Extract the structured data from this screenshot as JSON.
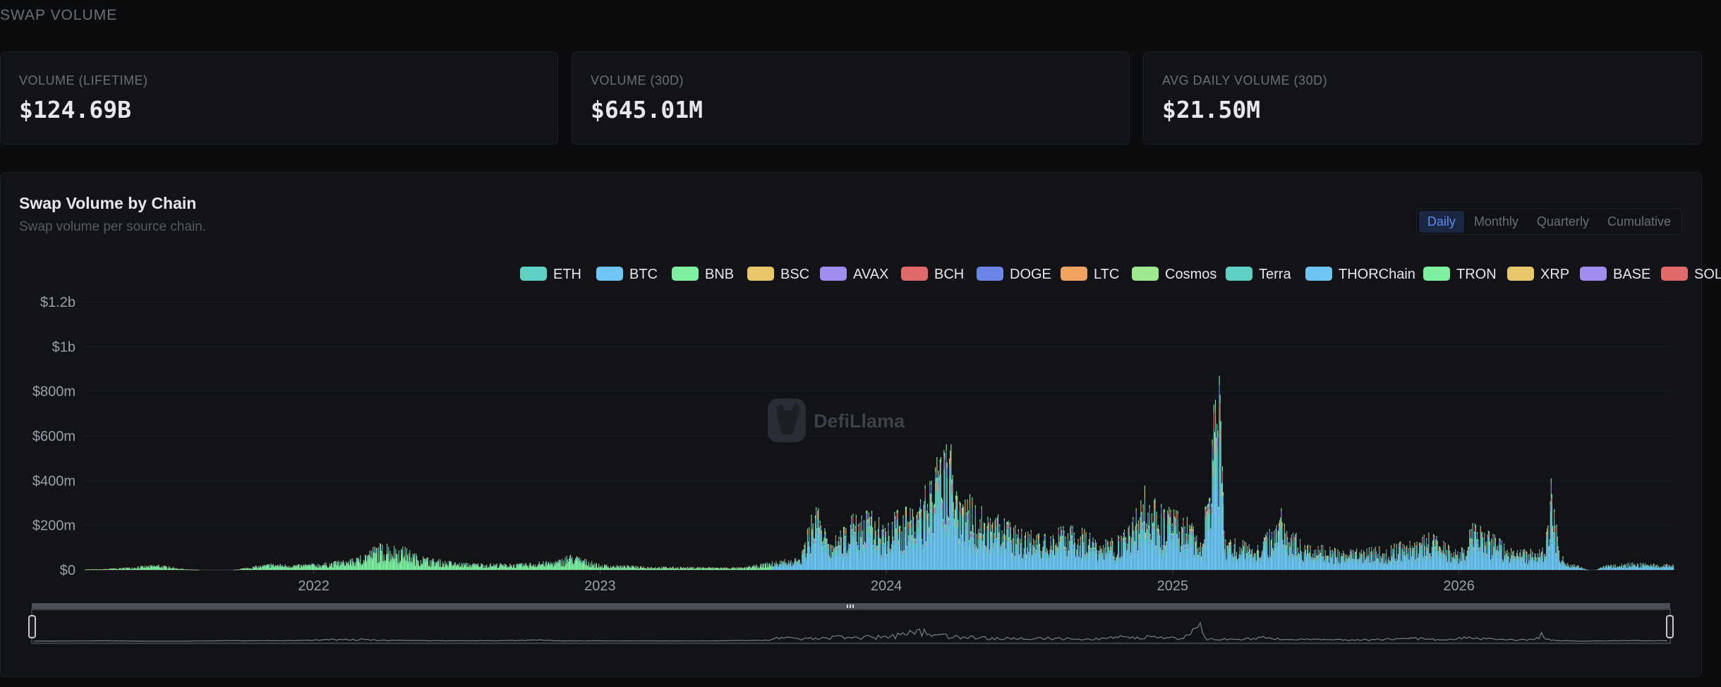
{
  "section_title": "SWAP VOLUME",
  "stats": [
    {
      "label": "VOLUME (LIFETIME)",
      "value": "$124.69B"
    },
    {
      "label": "VOLUME (30D)",
      "value": "$645.01M"
    },
    {
      "label": "AVG DAILY VOLUME (30D)",
      "value": "$21.50M"
    }
  ],
  "tabs": [
    {
      "label": "Daily",
      "active": true
    },
    {
      "label": "Monthly",
      "active": false
    },
    {
      "label": "Quarterly",
      "active": false
    },
    {
      "label": "Cumulative",
      "active": false
    }
  ],
  "watermark": "DefiLlama",
  "chart_data": {
    "type": "bar",
    "stacked": true,
    "title": "Swap Volume by Chain",
    "subtitle": "Swap volume per source chain.",
    "y_axis": {
      "min": 0,
      "max": 1200000000,
      "ticks": [
        0,
        200000000,
        400000000,
        600000000,
        800000000,
        1000000000,
        1200000000
      ],
      "tick_labels": [
        "$0",
        "$200m",
        "$400m",
        "$600m",
        "$800m",
        "$1b",
        "$1.2b"
      ]
    },
    "x_axis": {
      "range": [
        2021.2,
        2026.75
      ],
      "ticks": [
        2022,
        2023,
        2024,
        2025,
        2026
      ],
      "tick_labels": [
        "2022",
        "2023",
        "2024",
        "2025",
        "2026"
      ]
    },
    "grid": true,
    "legend_position": "top-right",
    "legend": [
      {
        "name": "ETH",
        "color": "#5ed1c4"
      },
      {
        "name": "BTC",
        "color": "#6ec6f5"
      },
      {
        "name": "BNB",
        "color": "#7ef0a0"
      },
      {
        "name": "BSC",
        "color": "#e8c76a"
      },
      {
        "name": "AVAX",
        "color": "#a18cf0"
      },
      {
        "name": "BCH",
        "color": "#e06a6a"
      },
      {
        "name": "DOGE",
        "color": "#6c86e8"
      },
      {
        "name": "LTC",
        "color": "#f0a35e"
      },
      {
        "name": "Cosmos",
        "color": "#a0e890"
      },
      {
        "name": "Terra",
        "color": "#5ed1c4"
      },
      {
        "name": "THORChain",
        "color": "#6ec6f5"
      },
      {
        "name": "TRON",
        "color": "#7ef0a0"
      },
      {
        "name": "XRP",
        "color": "#e8c76a"
      },
      {
        "name": "BASE",
        "color": "#a18cf0"
      },
      {
        "name": "SOL",
        "color": "#e06a6a"
      }
    ],
    "envelope": [
      [
        2021.25,
        3000000
      ],
      [
        2021.35,
        12000000
      ],
      [
        2021.45,
        25000000
      ],
      [
        2021.5,
        15000000
      ],
      [
        2021.55,
        3000000
      ],
      [
        2021.6,
        0
      ],
      [
        2021.72,
        0
      ],
      [
        2021.75,
        8000000
      ],
      [
        2021.85,
        30000000
      ],
      [
        2021.95,
        25000000
      ],
      [
        2022.05,
        35000000
      ],
      [
        2022.15,
        55000000
      ],
      [
        2022.22,
        120000000
      ],
      [
        2022.3,
        115000000
      ],
      [
        2022.38,
        60000000
      ],
      [
        2022.5,
        35000000
      ],
      [
        2022.7,
        28000000
      ],
      [
        2022.85,
        45000000
      ],
      [
        2022.9,
        75000000
      ],
      [
        2023.0,
        25000000
      ],
      [
        2023.2,
        15000000
      ],
      [
        2023.5,
        12000000
      ],
      [
        2023.6,
        40000000
      ],
      [
        2023.7,
        60000000
      ],
      [
        2023.75,
        350000000
      ],
      [
        2023.8,
        120000000
      ],
      [
        2023.9,
        280000000
      ],
      [
        2024.0,
        250000000
      ],
      [
        2024.1,
        300000000
      ],
      [
        2024.18,
        520000000
      ],
      [
        2024.22,
        580000000
      ],
      [
        2024.28,
        350000000
      ],
      [
        2024.35,
        280000000
      ],
      [
        2024.45,
        200000000
      ],
      [
        2024.55,
        160000000
      ],
      [
        2024.65,
        220000000
      ],
      [
        2024.75,
        130000000
      ],
      [
        2024.85,
        200000000
      ],
      [
        2024.9,
        380000000
      ],
      [
        2024.95,
        300000000
      ],
      [
        2025.05,
        250000000
      ],
      [
        2025.1,
        120000000
      ],
      [
        2025.15,
        850000000
      ],
      [
        2025.16,
        1000000000
      ],
      [
        2025.18,
        150000000
      ],
      [
        2025.3,
        120000000
      ],
      [
        2025.38,
        280000000
      ],
      [
        2025.45,
        130000000
      ],
      [
        2025.6,
        90000000
      ],
      [
        2025.75,
        110000000
      ],
      [
        2025.9,
        170000000
      ],
      [
        2026.0,
        80000000
      ],
      [
        2026.05,
        220000000
      ],
      [
        2026.2,
        90000000
      ],
      [
        2026.3,
        100000000
      ],
      [
        2026.32,
        460000000
      ],
      [
        2026.35,
        80000000
      ],
      [
        2026.38,
        40000000
      ],
      [
        2026.45,
        0
      ],
      [
        2026.48,
        0
      ],
      [
        2026.5,
        20000000
      ],
      [
        2026.6,
        35000000
      ],
      [
        2026.75,
        25000000
      ]
    ]
  }
}
